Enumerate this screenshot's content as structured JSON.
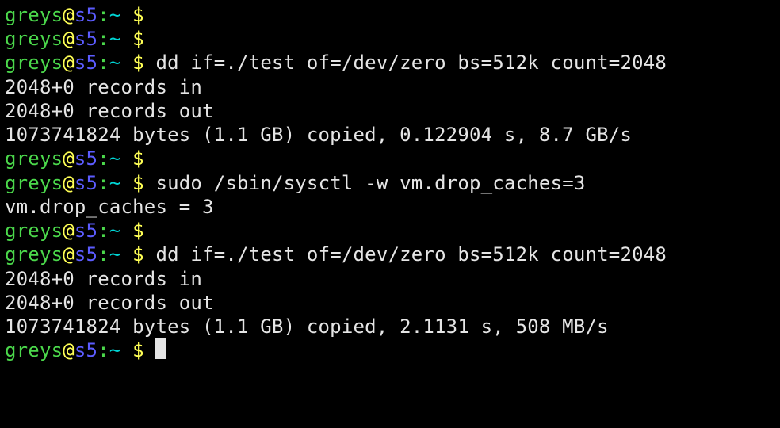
{
  "prompt": {
    "user": "greys",
    "at": "@",
    "host": "s5",
    "colon": ":",
    "cwd": "~",
    "dollar": " $ "
  },
  "lines": [
    {
      "type": "prompt",
      "command": ""
    },
    {
      "type": "prompt",
      "command": ""
    },
    {
      "type": "prompt",
      "command": "dd if=./test of=/dev/zero bs=512k count=2048"
    },
    {
      "type": "output",
      "text": "2048+0 records in"
    },
    {
      "type": "output",
      "text": "2048+0 records out"
    },
    {
      "type": "output",
      "text": "1073741824 bytes (1.1 GB) copied, 0.122904 s, 8.7 GB/s"
    },
    {
      "type": "prompt",
      "command": ""
    },
    {
      "type": "prompt",
      "command": "sudo /sbin/sysctl -w vm.drop_caches=3"
    },
    {
      "type": "output",
      "text": "vm.drop_caches = 3"
    },
    {
      "type": "prompt",
      "command": ""
    },
    {
      "type": "prompt",
      "command": "dd if=./test of=/dev/zero bs=512k count=2048"
    },
    {
      "type": "output",
      "text": "2048+0 records in"
    },
    {
      "type": "output",
      "text": "2048+0 records out"
    },
    {
      "type": "output",
      "text": "1073741824 bytes (1.1 GB) copied, 2.1131 s, 508 MB/s"
    },
    {
      "type": "prompt",
      "command": "",
      "cursor": true
    }
  ]
}
